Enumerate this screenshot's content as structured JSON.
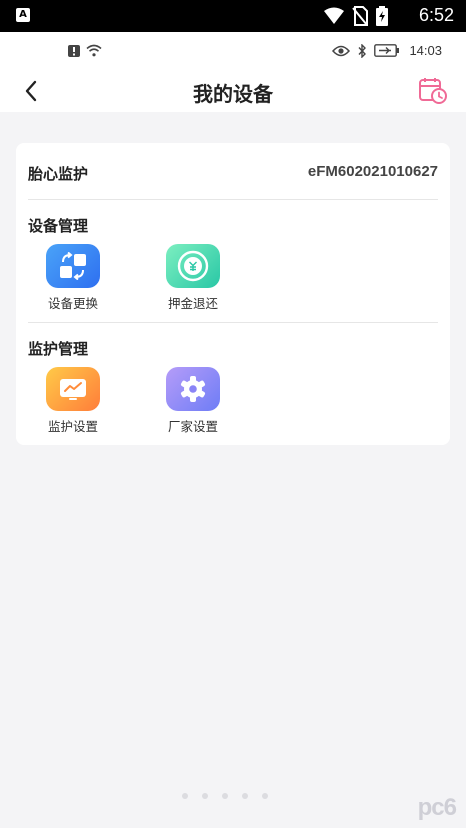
{
  "system_bar": {
    "time": "6:52",
    "left_icon": "A",
    "icons": [
      "wifi-icon",
      "no-sim-icon",
      "battery-charging-icon"
    ]
  },
  "inner_status": {
    "time": "14:03",
    "left_icons": [
      "alert-icon",
      "wifi-icon"
    ],
    "right_icons": [
      "eye-icon",
      "bluetooth-icon",
      "battery-icon"
    ]
  },
  "nav": {
    "title": "我的设备",
    "back_icon": "chevron-left-icon",
    "history_icon": "calendar-clock-icon"
  },
  "monitor": {
    "label": "胎心监护",
    "device_id": "eFM602021010627"
  },
  "sections": {
    "device_mgmt": {
      "title": "设备管理",
      "items": [
        {
          "label": "设备更换",
          "icon": "swap-device-icon"
        },
        {
          "label": "押金退还",
          "icon": "deposit-refund-icon"
        }
      ]
    },
    "monitor_mgmt": {
      "title": "监护管理",
      "items": [
        {
          "label": "监护设置",
          "icon": "monitor-chart-icon"
        },
        {
          "label": "厂家设置",
          "icon": "gear-icon"
        }
      ]
    }
  },
  "watermark": "pc6",
  "colors": {
    "accent_pink": "#f06a96",
    "blue": "#3a86f4",
    "green": "#2ccaa8",
    "orange": "#ff8c3a",
    "purple": "#8a84f6",
    "background": "#f4f4f6"
  }
}
